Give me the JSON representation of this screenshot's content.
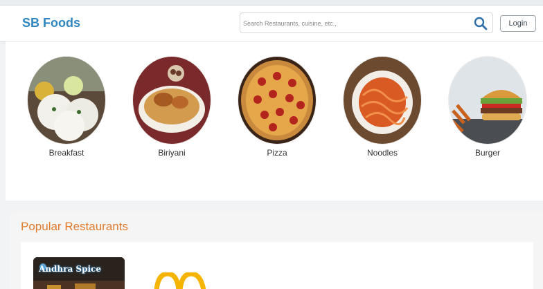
{
  "header": {
    "brand": "SB Foods",
    "search_placeholder": "Search Restaurants, cuisine, etc.,",
    "login_label": "Login"
  },
  "categories": [
    {
      "label": "Breakfast"
    },
    {
      "label": "Biriyani"
    },
    {
      "label": "Pizza"
    },
    {
      "label": "Noodles"
    },
    {
      "label": "Burger"
    }
  ],
  "popular": {
    "title": "Popular Restaurants",
    "restaurants": [
      {
        "name": "Andhra Spice"
      }
    ]
  },
  "colors": {
    "brand": "#2f86c1",
    "section_title": "#e07b2e",
    "mcd_arches": "#f5b400"
  },
  "icons": [
    "search-icon",
    "mcdonalds-logo"
  ]
}
